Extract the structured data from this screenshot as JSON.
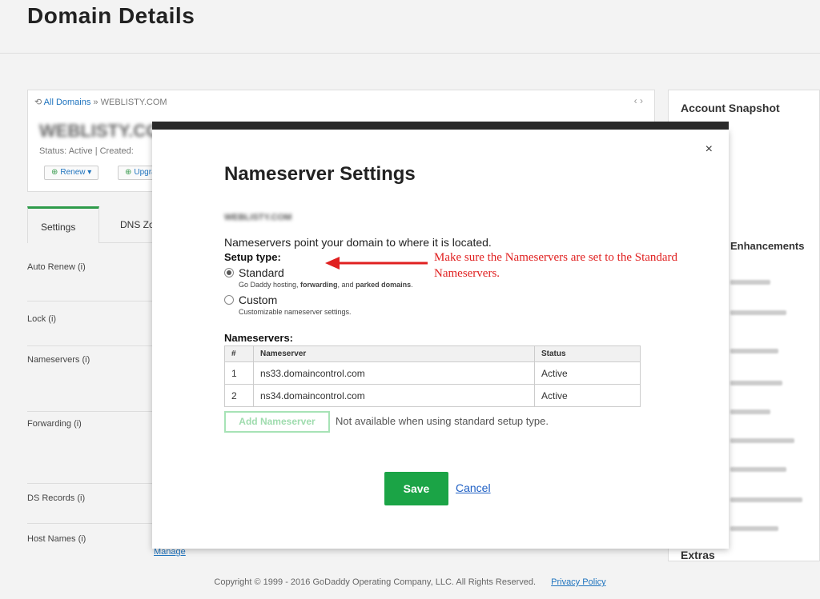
{
  "page": {
    "title": "Domain Details",
    "breadcrumb": {
      "all_domains": "All Domains",
      "separator": "»",
      "current": "WEBLISTY.COM"
    },
    "domain_name": "WEBLISTY.COM",
    "status_text": "Status: Active  |  Created:",
    "card_buttons": [
      "Renew",
      "Upgrade"
    ],
    "tabs": [
      "Settings",
      "DNS Zone"
    ],
    "settings_rows": [
      "Auto Renew (i)",
      "Lock (i)",
      "Nameservers (i)",
      "Forwarding (i)",
      "DS Records (i)",
      "Host Names (i)"
    ],
    "manage_link": "Manage",
    "sidebar": {
      "title": "Account Snapshot",
      "section2": "Enhancements",
      "extras": "Extras"
    },
    "footer": {
      "copyright": "Copyright © 1999 - 2016 GoDaddy Operating Company, LLC. All Rights Reserved.",
      "privacy": "Privacy Policy"
    }
  },
  "modal": {
    "close_icon": "×",
    "title": "Nameserver Settings",
    "domain": "WEBLISTY.COM",
    "intro": "Nameservers point your domain to where it is located.",
    "setup_type_label": "Setup type:",
    "options": [
      {
        "label": "Standard",
        "selected": true,
        "desc_parts": [
          "Go Daddy hosting, ",
          "forwarding",
          ", and ",
          "parked domains",
          "."
        ]
      },
      {
        "label": "Custom",
        "selected": false,
        "desc": "Customizable nameserver settings."
      }
    ],
    "annotation": "Make sure the Nameservers are set to the Standard Nameservers.",
    "nameservers_label": "Nameservers:",
    "table": {
      "headers": [
        "#",
        "Nameserver",
        "Status"
      ],
      "rows": [
        [
          "1",
          "ns33.domaincontrol.com",
          "Active"
        ],
        [
          "2",
          "ns34.domaincontrol.com",
          "Active"
        ]
      ]
    },
    "add_button": "Add Nameserver",
    "add_note": "Not available when using standard setup type.",
    "save_button": "Save",
    "cancel_link": "Cancel"
  },
  "colors": {
    "accent_green": "#1ba446",
    "link_blue": "#1e5fc4",
    "annotation_red": "#e02020"
  }
}
